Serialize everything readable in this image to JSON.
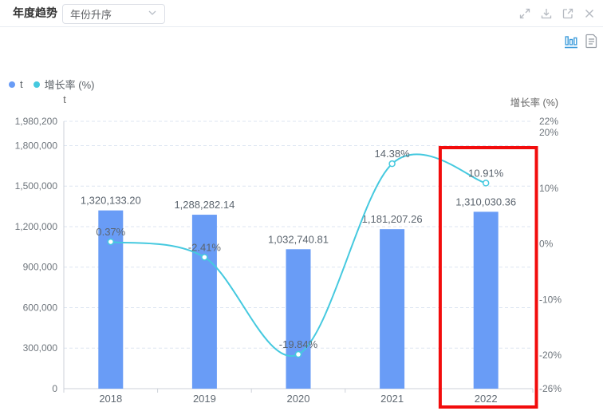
{
  "header": {
    "title": "年度趋势",
    "sort_dropdown": {
      "value": "年份升序"
    },
    "window_actions": [
      {
        "icon": "expand-icon"
      },
      {
        "icon": "download-icon"
      },
      {
        "icon": "external-link-icon"
      },
      {
        "icon": "close-icon"
      }
    ]
  },
  "view_toolbar": {
    "chart_view": {
      "icon": "bar-chart-icon",
      "active": true,
      "active_color": "#3e9cdb"
    },
    "table_view": {
      "icon": "document-icon",
      "active": false
    }
  },
  "legend": {
    "items": [
      {
        "label": "t",
        "color": "#699cf6"
      },
      {
        "label": "增长率 (%)",
        "color": "#45c9df"
      }
    ]
  },
  "chart_data": {
    "type": "bar+line",
    "categories": [
      "2018",
      "2019",
      "2020",
      "2021",
      "2022"
    ],
    "series": [
      {
        "name": "t",
        "type": "bar",
        "axis": "left",
        "color": "#699cf6",
        "values": [
          1320133.2,
          1288282.14,
          1032740.81,
          1181207.26,
          1310030.36
        ],
        "labels": [
          "1,320,133.20",
          "1,288,282.14",
          "1,032,740.81",
          "1,181,207.26",
          "1,310,030.36"
        ]
      },
      {
        "name": "增长率 (%)",
        "type": "line",
        "smooth": true,
        "axis": "right",
        "color": "#45c9df",
        "values": [
          0.37,
          -2.41,
          -19.84,
          14.38,
          10.91
        ],
        "labels": [
          "0.37%",
          "-2.41%",
          "-19.84%",
          "14.38%",
          "10.91%"
        ]
      }
    ],
    "left_axis": {
      "title": "t",
      "min": 0,
      "max": 1980200,
      "tick_values": [
        1980200,
        1800000,
        1500000,
        1200000,
        900000,
        600000,
        300000,
        0
      ],
      "tick_labels": [
        "1,980,200",
        "1,800,000",
        "1,500,000",
        "1,200,000",
        "900,000",
        "600,000",
        "300,000",
        "0"
      ]
    },
    "right_axis": {
      "title": "增长率 (%)",
      "min": -26,
      "max": 22,
      "tick_values": [
        22,
        20,
        10,
        0,
        -10,
        -20,
        -26
      ],
      "tick_labels": [
        "22%",
        "20%",
        "10%",
        "0%",
        "-10%",
        "-20%",
        "-26%"
      ]
    },
    "grid": true,
    "legend_position": "top-left",
    "highlight": {
      "category": "2022",
      "color": "#f20c0c"
    }
  }
}
